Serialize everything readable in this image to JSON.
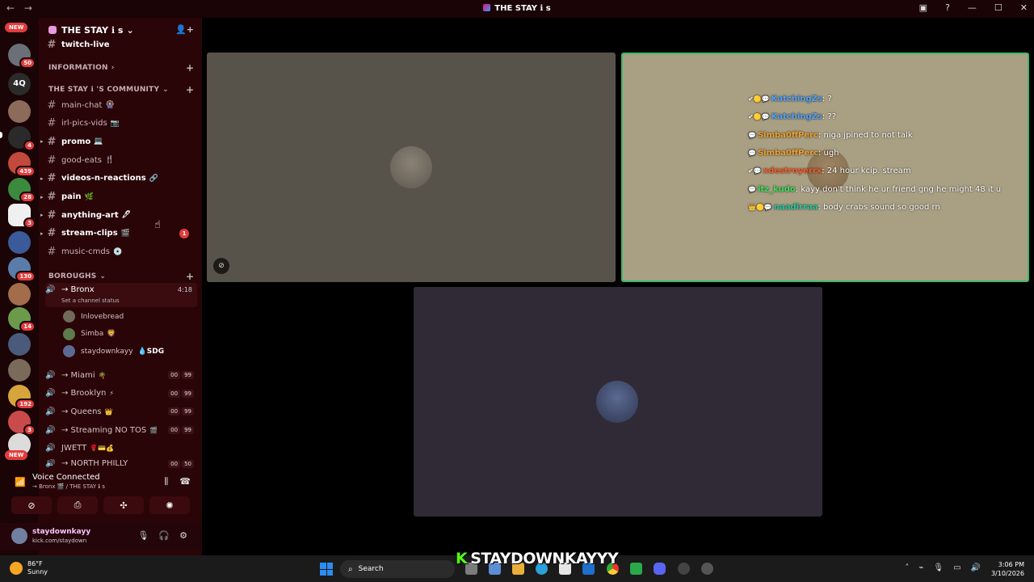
{
  "window": {
    "title": "THE STAY ℹ s",
    "back": "←",
    "forward": "→"
  },
  "server": {
    "name": "THE STAY ℹ s",
    "chevron": "⌄"
  },
  "rail": {
    "badges": [
      "NEW",
      "50",
      "4Q",
      "4",
      "439",
      "28",
      "3",
      "130",
      "14",
      "192",
      "3",
      "NEW"
    ]
  },
  "categories": {
    "information": "INFORMATION",
    "community": "THE STAY ℹ 'S COMMUNITY",
    "boroughs": "BOROUGHS"
  },
  "top_channel": "twitch-live",
  "channels": [
    {
      "name": "main-chat",
      "emoji": "🎡",
      "bright": false
    },
    {
      "name": "irl-pics-vids",
      "emoji": "📷",
      "bright": false
    },
    {
      "name": "promo",
      "emoji": "💻",
      "bright": true
    },
    {
      "name": "good-eats",
      "emoji": "🍴",
      "bright": false
    },
    {
      "name": "videos-n-reactions",
      "emoji": "🔗",
      "bright": true
    },
    {
      "name": "pain",
      "emoji": "🌿",
      "bright": true
    },
    {
      "name": "anything-art",
      "emoji": "🖊",
      "bright": true
    },
    {
      "name": "stream-clips",
      "emoji": "🎬",
      "bright": true,
      "unread": "1"
    },
    {
      "name": "music-cmds",
      "emoji": "💿",
      "bright": false
    }
  ],
  "active_voice": {
    "name": "→ Bronx",
    "timer": "4:18",
    "status": "Set a channel status"
  },
  "members": [
    {
      "name": "Inlovebread"
    },
    {
      "name": "Simba",
      "emoji": "🦁"
    },
    {
      "name": "staydownkayy",
      "tag": "💧SDG"
    }
  ],
  "voice_channels": [
    {
      "name": "→ Miami",
      "emoji": "🌴",
      "counts": [
        "00",
        "99"
      ]
    },
    {
      "name": "→ Brooklyn",
      "emoji": "⚡",
      "counts": [
        "00",
        "99"
      ]
    },
    {
      "name": "→ Queens",
      "emoji": "👑",
      "counts": [
        "00",
        "99"
      ]
    },
    {
      "name": "→ Streaming NO TOS",
      "emoji": "🎬",
      "counts": [
        "00",
        "99"
      ]
    },
    {
      "name": "JWETT",
      "emoji": "🌹💳💰",
      "counts": []
    },
    {
      "name": "→ NORTH PHILLY",
      "emoji": "",
      "counts": [
        "00",
        "50"
      ]
    }
  ],
  "voice_panel": {
    "title": "Voice Connected",
    "subtitle": "→ Bronx 🎬 / THE STAY ℹ s"
  },
  "user": {
    "name": "staydownkayy",
    "status": "kick.com/staydown"
  },
  "chat_lines": [
    {
      "badges": "✔🟡💬",
      "user": "KatchingZs",
      "color": "#4fa3ff",
      "text": "?"
    },
    {
      "badges": "✔🟡💬",
      "user": "KatchingZs",
      "color": "#4fa3ff",
      "text": "??"
    },
    {
      "badges": "💬",
      "user": "Simba0ffPerc",
      "color": "#f0a030",
      "text": "niga jpined to not talk"
    },
    {
      "badges": "💬",
      "user": "Simba0ffPerc",
      "color": "#f0a030",
      "text": "ugh"
    },
    {
      "badges": "✔💬",
      "user": "xdestroyerrx",
      "color": "#ff5a2a",
      "text": "24 hour kcip. stream"
    },
    {
      "badges": "💬",
      "user": "itz_kudo",
      "color": "#40e060",
      "text": "kayy don't think he ur friend gng he might 48 it u"
    },
    {
      "badges": "👑🟡💬",
      "user": "naadirraa",
      "color": "#20c8a0",
      "text": "body crabs sound so good rn"
    }
  ],
  "overlay_name": "STAYDOWNKAYYY",
  "taskbar": {
    "temp": "86°F",
    "weather": "Sunny",
    "search": "Search",
    "time": "3:06 PM",
    "date": "3/10/2026"
  }
}
